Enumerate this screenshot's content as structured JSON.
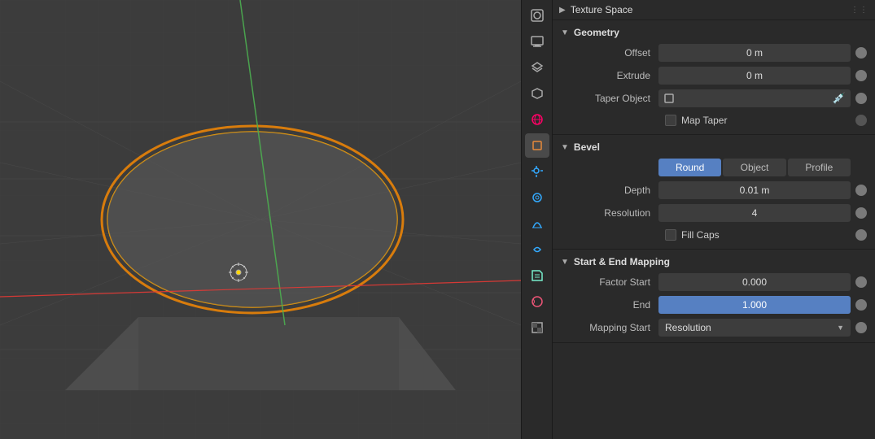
{
  "viewport": {
    "bg_color": "#3d3d3d"
  },
  "sidebar_icons": [
    {
      "name": "render-icon",
      "symbol": "📷",
      "active": false
    },
    {
      "name": "output-icon",
      "symbol": "🖼",
      "active": false
    },
    {
      "name": "view-layer-icon",
      "symbol": "🏔",
      "active": false
    },
    {
      "name": "scene-icon",
      "symbol": "🌐",
      "active": false
    },
    {
      "name": "world-icon",
      "symbol": "🌍",
      "active": false
    },
    {
      "name": "object-icon",
      "symbol": "◻",
      "active": true
    },
    {
      "name": "modifier-icon",
      "symbol": "🔧",
      "active": false
    },
    {
      "name": "particles-icon",
      "symbol": "⬤",
      "active": false
    },
    {
      "name": "physics-icon",
      "symbol": "◎",
      "active": false
    },
    {
      "name": "constraints-icon",
      "symbol": "🔗",
      "active": false
    },
    {
      "name": "data-icon",
      "symbol": "↩",
      "active": false
    },
    {
      "name": "material-icon",
      "symbol": "◑",
      "active": false
    },
    {
      "name": "texture-icon",
      "symbol": "▦",
      "active": false
    }
  ],
  "properties": {
    "texture_space": {
      "label": "Texture Space",
      "header_dots": "⋮⋮"
    },
    "geometry": {
      "label": "Geometry",
      "offset": {
        "label": "Offset",
        "value": "0 m"
      },
      "extrude": {
        "label": "Extrude",
        "value": "0 m"
      },
      "taper_object": {
        "label": "Taper Object",
        "icon_symbol": "◻",
        "placeholder": ""
      },
      "map_taper": {
        "label": "Map Taper",
        "checked": false
      }
    },
    "bevel": {
      "label": "Bevel",
      "modes": [
        {
          "label": "Round",
          "active": true
        },
        {
          "label": "Object",
          "active": false
        },
        {
          "label": "Profile",
          "active": false
        }
      ],
      "depth": {
        "label": "Depth",
        "value": "0.01 m"
      },
      "resolution": {
        "label": "Resolution",
        "value": "4"
      },
      "fill_caps": {
        "label": "Fill Caps",
        "checked": false
      }
    },
    "start_end_mapping": {
      "label": "Start & End Mapping",
      "factor_start": {
        "label": "Factor Start",
        "value": "0.000"
      },
      "end": {
        "label": "End",
        "value": "1.000",
        "highlighted": true
      },
      "mapping_start": {
        "label": "Mapping Start",
        "value": "Resolution",
        "is_dropdown": true
      }
    }
  }
}
